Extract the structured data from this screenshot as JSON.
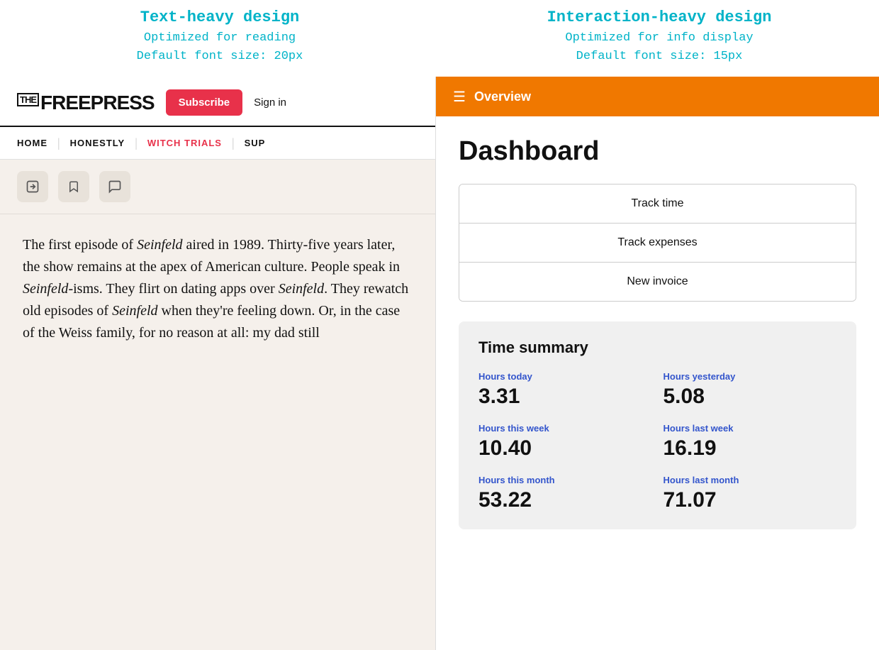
{
  "topLabels": {
    "left": {
      "heading": "Text-heavy design",
      "line1": "Optimized for reading",
      "line2": "Default font size: 20px"
    },
    "right": {
      "heading": "Interaction-heavy design",
      "line1": "Optimized for info display",
      "line2": "Default font size: 15px"
    }
  },
  "leftPanel": {
    "logo": {
      "the": "THE",
      "freepress": "FREEPRESS"
    },
    "subscribeLabel": "Subscribe",
    "signinLabel": "Sign in",
    "nav": [
      {
        "label": "HOME",
        "active": false
      },
      {
        "label": "HONESTLY",
        "active": false
      },
      {
        "label": "WITCH TRIALS",
        "active": true
      },
      {
        "label": "SUP",
        "active": false
      }
    ],
    "articleText": "The first episode of Seinfeld aired in 1989. Thirty-five years later, the show remains at the apex of American culture. People speak in Seinfeld-isms. They flirt on dating apps over Seinfeld. They rewatch old episodes of Seinfeld when they're feeling down. Or, in the case of the Weiss family, for no reason at all: my dad still"
  },
  "rightPanel": {
    "topNav": {
      "title": "Overview"
    },
    "dashboard": {
      "title": "Dashboard",
      "buttons": [
        {
          "label": "Track time"
        },
        {
          "label": "Track expenses"
        },
        {
          "label": "New invoice"
        }
      ],
      "timeSummary": {
        "title": "Time summary",
        "cells": [
          {
            "label": "Hours today",
            "value": "3.31"
          },
          {
            "label": "Hours yesterday",
            "value": "5.08"
          },
          {
            "label": "Hours this week",
            "value": "10.40"
          },
          {
            "label": "Hours last week",
            "value": "16.19"
          },
          {
            "label": "Hours this month",
            "value": "53.22"
          },
          {
            "label": "Hours last month",
            "value": "71.07"
          }
        ]
      }
    }
  }
}
